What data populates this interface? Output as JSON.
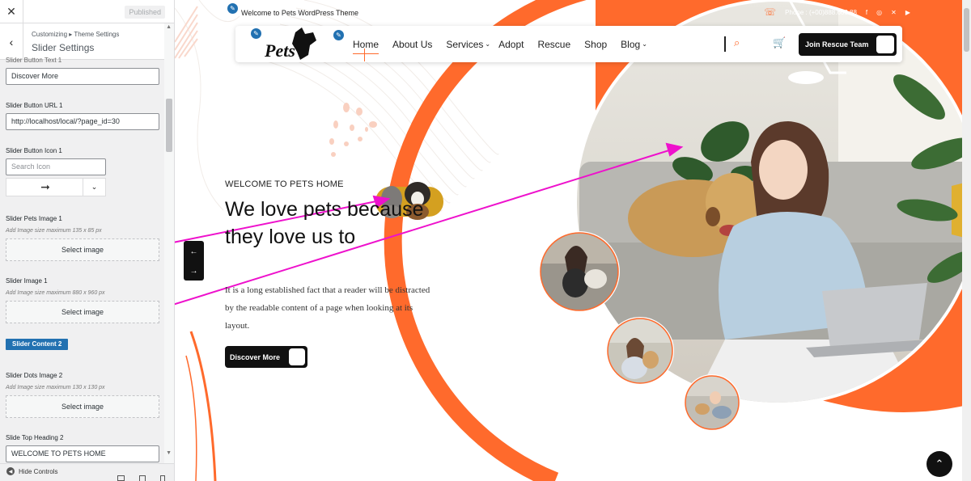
{
  "customizer": {
    "published": "Published",
    "breadcrumb": "Customizing ▸ Theme Settings",
    "panel_title": "Slider Settings",
    "fields": {
      "button_text_label": "Slider Button Text 1",
      "button_text_value": "Discover More",
      "button_url_label": "Slider Button URL 1",
      "button_url_value": "http://localhost/local/?page_id=30",
      "button_icon_label": "Slider Button Icon 1",
      "button_icon_placeholder": "Search Icon",
      "pets_image_label": "Slider Pets Image 1",
      "pets_image_note": "Add Image size maximum 135 x 85 px",
      "pets_image_button": "Select image",
      "slider_image_label": "Slider Image 1",
      "slider_image_note": "Add Image size maximum 880 x 960 px",
      "slider_image_button": "Select image",
      "section_button": "Slider Content 2",
      "dots_image_label": "Slider Dots Image 2",
      "dots_image_note": "Add Image size maximum 130 x 130 px",
      "dots_image_button": "Select image",
      "top_heading_label": "Slide Top Heading 2",
      "top_heading_value": "WELCOME TO PETS HOME"
    },
    "hide_controls": "Hide Controls"
  },
  "site": {
    "welcome": "Welcome to Pets WordPress Theme",
    "phone": "Phone : (+00)888.666.88",
    "logo_text": "Pets",
    "nav": [
      "Home",
      "About Us",
      "Services",
      "Adopt",
      "Rescue",
      "Shop",
      "Blog"
    ],
    "join_button": "Join Rescue Team",
    "hero": {
      "small_heading": "WELCOME TO PETS HOME",
      "title": "We love pets because they love us to",
      "description": "It is a long established fact that a reader will be distracted by the readable content of a page when looking at its layout.",
      "button": "Discover More"
    }
  },
  "colors": {
    "accent": "#ff6a2c",
    "wp_blue": "#2271b1",
    "magenta_annotation": "#ee11cc"
  }
}
